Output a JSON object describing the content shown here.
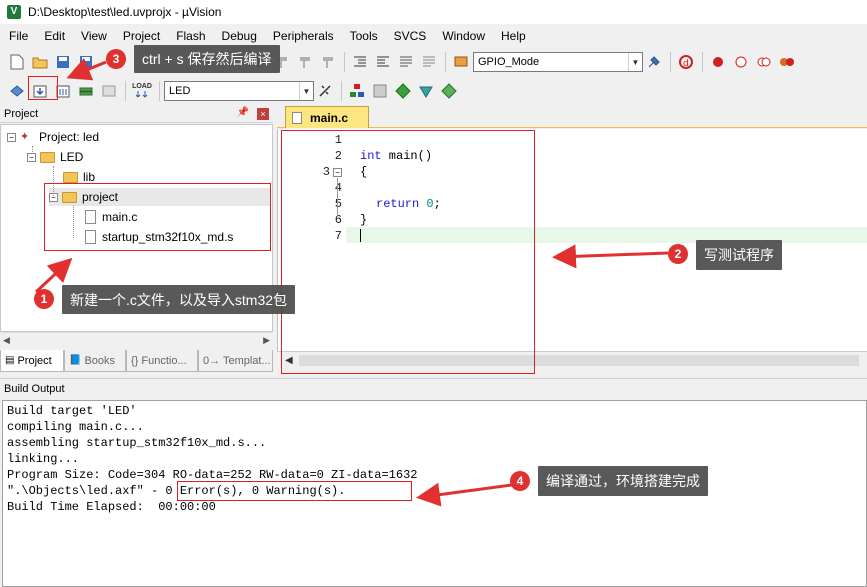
{
  "window": {
    "title": "D:\\Desktop\\test\\led.uvprojx - µVision",
    "app_icon": "V"
  },
  "menu": [
    "File",
    "Edit",
    "View",
    "Project",
    "Flash",
    "Debug",
    "Peripherals",
    "Tools",
    "SVCS",
    "Window",
    "Help"
  ],
  "toolbar1": {
    "target_combo": "GPIO_Mode"
  },
  "toolbar2": {
    "target_select": "LED",
    "load_label": "LOAD"
  },
  "project_panel": {
    "title": "Project",
    "tree": {
      "root": "Project: led",
      "target": "LED",
      "group_lib": "lib",
      "group_project": "project",
      "file1": "main.c",
      "file2": "startup_stm32f10x_md.s"
    },
    "tabs": [
      "Project",
      "Books",
      "{} Functio...",
      "0→ Templat..."
    ]
  },
  "editor": {
    "tab": "main.c",
    "line_numbers": [
      "1",
      "2",
      "3",
      "4",
      "5",
      "6",
      "7"
    ],
    "code": {
      "l2_kw": "int",
      "l2_rest": " main()",
      "l3": "{",
      "l5_kw": "return",
      "l5_num": "0",
      "l5_end": ";",
      "l6": "}"
    }
  },
  "build_output": {
    "title": "Build Output",
    "lines": [
      "Build target 'LED'",
      "compiling main.c...",
      "assembling startup_stm32f10x_md.s...",
      "linking...",
      "Program Size: Code=304 RO-data=252 RW-data=0 ZI-data=1632",
      "\".\\Objects\\led.axf\" - 0 Error(s), 0 Warning(s).",
      "Build Time Elapsed:  00:00:00"
    ]
  },
  "annotations": {
    "a1": {
      "num": "1",
      "text": "新建一个.c文件，以及导入stm32包"
    },
    "a2": {
      "num": "2",
      "text": "写测试程序"
    },
    "a3": {
      "num": "3",
      "text": "ctrl + s 保存然后编译"
    },
    "a4": {
      "num": "4",
      "text": "编译通过，环境搭建完成"
    }
  },
  "colors": {
    "annotation_red": "#e03030",
    "callout_bg": "#4b4b4b",
    "keyword": "#1b1bd6",
    "number": "#008a8a",
    "tab_yellow": "#fde680"
  }
}
